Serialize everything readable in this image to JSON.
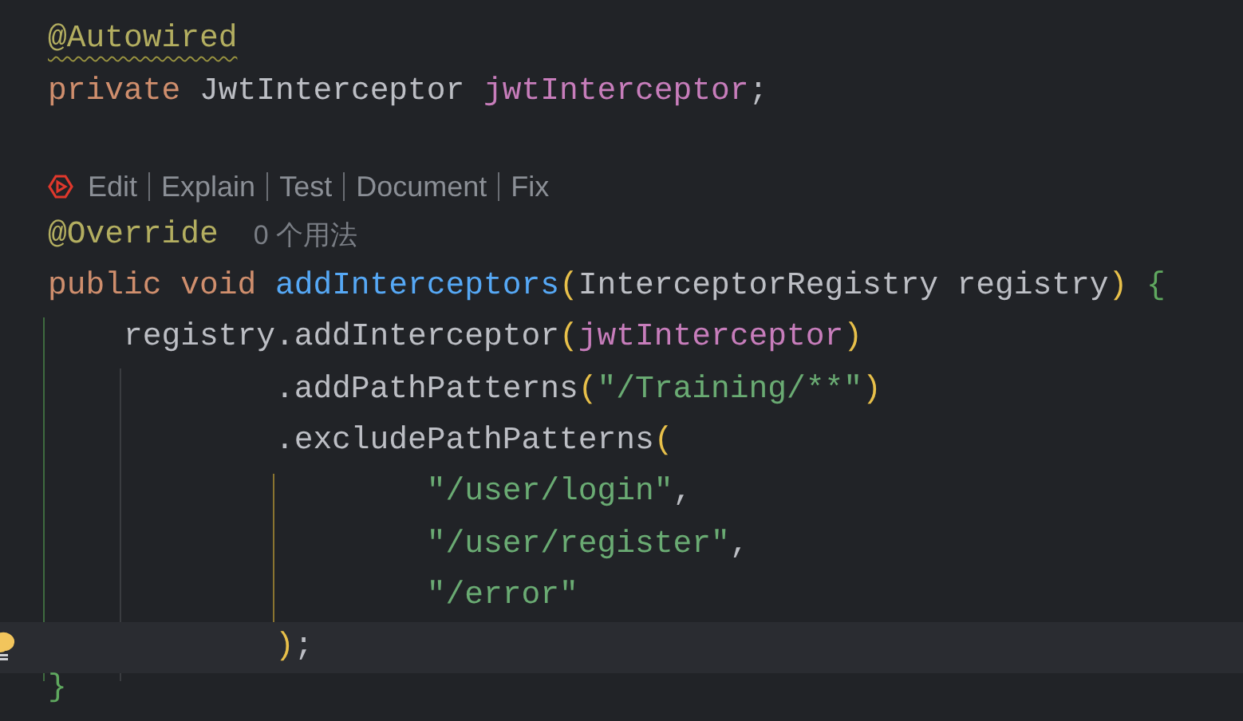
{
  "editor": {
    "lines": [
      {
        "kind": "code",
        "current": false,
        "tokens": [
          {
            "text": "@Autowired",
            "kind": "annotation",
            "warning": true
          }
        ]
      },
      {
        "kind": "code",
        "current": false,
        "tokens": [
          {
            "text": "private",
            "kind": "keyword"
          },
          {
            "text": " JwtInterceptor ",
            "kind": "plain"
          },
          {
            "text": "jwtInterceptor",
            "kind": "field"
          },
          {
            "text": ";",
            "kind": "plain"
          }
        ]
      },
      {
        "kind": "blank"
      },
      {
        "kind": "codelens",
        "actions": [
          "Edit",
          "Explain",
          "Test",
          "Document",
          "Fix"
        ]
      },
      {
        "kind": "code",
        "current": false,
        "tokens": [
          {
            "text": "@Override",
            "kind": "annotation",
            "warning": false
          },
          {
            "text": "0 个用法",
            "kind": "hint"
          }
        ]
      },
      {
        "kind": "code",
        "current": false,
        "tokens": [
          {
            "text": "public void ",
            "kind": "keyword"
          },
          {
            "text": "addInterceptors",
            "kind": "method"
          },
          {
            "text": "(",
            "kind": "paren"
          },
          {
            "text": "InterceptorRegistry registry",
            "kind": "plain"
          },
          {
            "text": ")",
            "kind": "paren"
          },
          {
            "text": " {",
            "kind": "brace"
          }
        ]
      },
      {
        "kind": "code",
        "current": false,
        "tokens": [
          {
            "text": "    registry.addInterceptor",
            "kind": "plain"
          },
          {
            "text": "(",
            "kind": "paren"
          },
          {
            "text": "jwtInterceptor",
            "kind": "field"
          },
          {
            "text": ")",
            "kind": "paren"
          }
        ]
      },
      {
        "kind": "code",
        "current": false,
        "tokens": [
          {
            "text": "            .addPathPatterns",
            "kind": "plain"
          },
          {
            "text": "(",
            "kind": "paren"
          },
          {
            "text": "\"/Training/**\"",
            "kind": "string"
          },
          {
            "text": ")",
            "kind": "paren"
          }
        ]
      },
      {
        "kind": "code",
        "current": false,
        "tokens": [
          {
            "text": "            .excludePathPatterns",
            "kind": "plain"
          },
          {
            "text": "(",
            "kind": "paren"
          }
        ]
      },
      {
        "kind": "code",
        "current": false,
        "tokens": [
          {
            "text": "                    \"/user/login\"",
            "kind": "string"
          },
          {
            "text": ",",
            "kind": "plain"
          }
        ]
      },
      {
        "kind": "code",
        "current": false,
        "tokens": [
          {
            "text": "                    \"/user/register\"",
            "kind": "string"
          },
          {
            "text": ",",
            "kind": "plain"
          }
        ]
      },
      {
        "kind": "code",
        "current": false,
        "tokens": [
          {
            "text": "                    \"/error\"",
            "kind": "string"
          }
        ]
      },
      {
        "kind": "code",
        "current": true,
        "tokens": [
          {
            "text": "            )",
            "kind": "paren"
          },
          {
            "text": ";",
            "kind": "plain"
          }
        ]
      },
      {
        "kind": "code",
        "current": false,
        "tokens": [
          {
            "text": "}",
            "kind": "brace"
          }
        ]
      }
    ]
  }
}
